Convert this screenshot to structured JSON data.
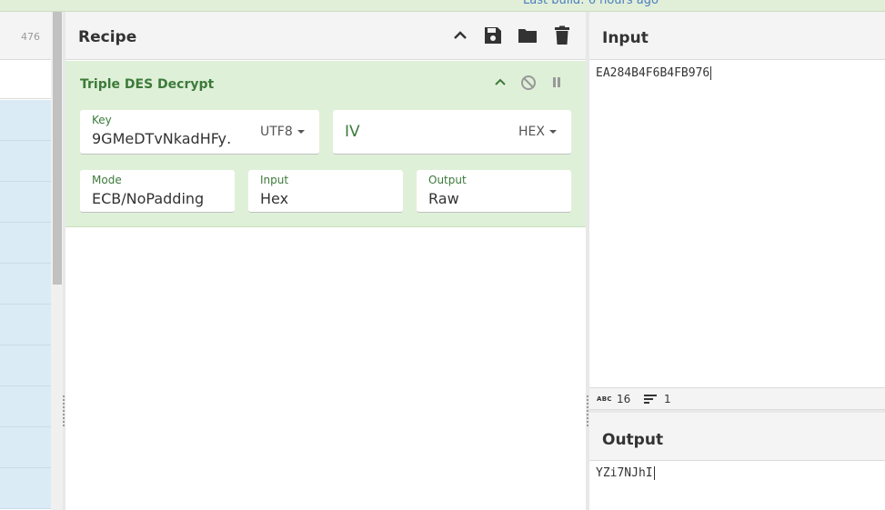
{
  "topbar": {
    "build_text": "Last build: 6 hours ago"
  },
  "operations": {
    "count": "476",
    "row_count": 10
  },
  "recipe": {
    "title": "Recipe",
    "icons": [
      "chevron-up-icon",
      "save-icon",
      "folder-icon",
      "trash-icon"
    ],
    "operation": {
      "title": "Triple DES Decrypt",
      "icons": [
        "chevron-up-icon",
        "disable-icon",
        "pause-icon"
      ],
      "key": {
        "label": "Key",
        "value": "9GMeDTvNkadHFy…",
        "encoding": "UTF8"
      },
      "iv": {
        "placeholder": "IV",
        "encoding": "HEX"
      },
      "mode": {
        "label": "Mode",
        "value": "ECB/NoPadding"
      },
      "input": {
        "label": "Input",
        "value": "Hex"
      },
      "output": {
        "label": "Output",
        "value": "Raw"
      }
    }
  },
  "io": {
    "input": {
      "title": "Input",
      "text": "EA284B4F6B4FB976"
    },
    "status": {
      "length_label": "ABC",
      "length": "16",
      "lines": "1"
    },
    "output": {
      "title": "Output",
      "text": "YZi7NJhI"
    }
  },
  "colors": {
    "accent_green": "#3c7a3a",
    "card_bg": "#dff0d8",
    "op_row_bg": "#dbebf5"
  }
}
